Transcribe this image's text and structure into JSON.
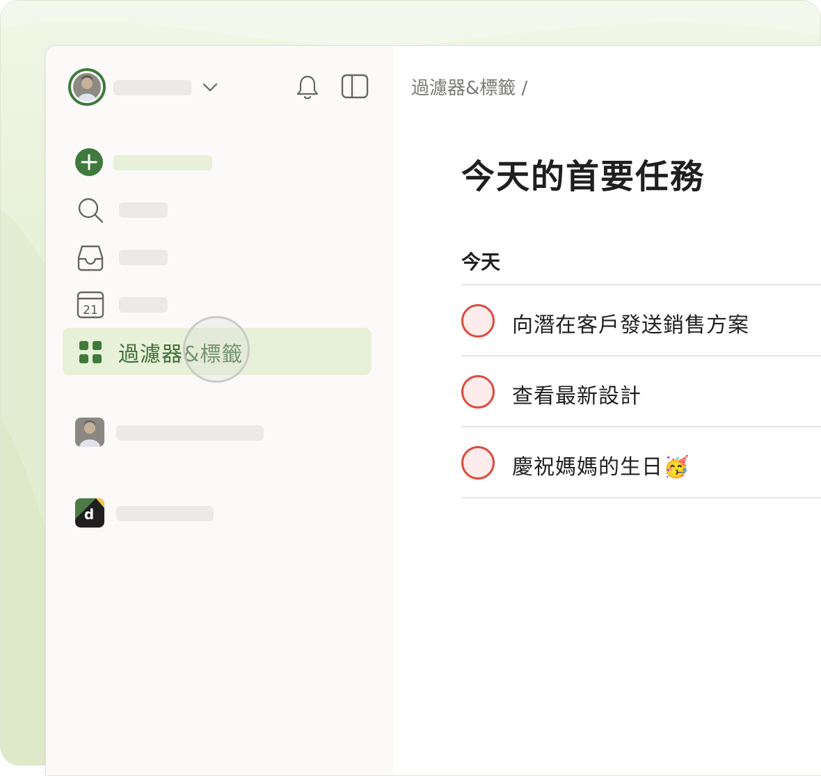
{
  "sidebar": {
    "active_item": {
      "label": "過濾器&標籤",
      "icon": "filters-grid-icon"
    },
    "nav_icons": [
      "add-task-icon",
      "search-icon",
      "inbox-icon",
      "calendar-today-icon"
    ],
    "calendar_day": "21",
    "workspace_letter": "d",
    "header_icons": [
      "bell-icon",
      "sidebar-toggle-icon",
      "chevron-down-icon"
    ]
  },
  "main": {
    "breadcrumb": "過濾器&標籤 /",
    "title": "今天的首要任務",
    "section": "今天",
    "tasks": [
      {
        "label": "向潛在客戶發送銷售方案"
      },
      {
        "label": "查看最新設計"
      },
      {
        "label": "慶祝媽媽的生日🥳"
      }
    ]
  },
  "colors": {
    "accent_green": "#3f7a3c",
    "active_bg": "#e7f1d7",
    "task_red": "#dc4c3e",
    "task_fill": "#fdeceb"
  }
}
